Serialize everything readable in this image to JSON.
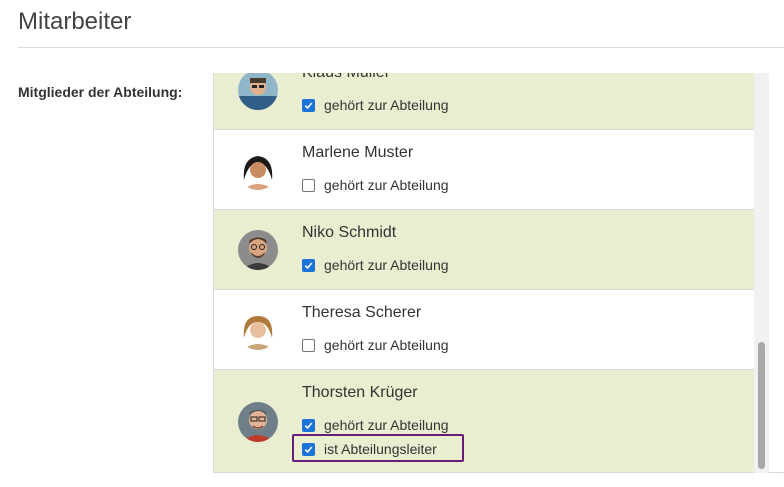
{
  "page": {
    "title": "Mitarbeiter"
  },
  "field": {
    "label": "Mitglieder der Abteilung:"
  },
  "members": [
    {
      "name": "Klaus Müller",
      "selected": true,
      "checkbox_label": "gehört zur Abteilung",
      "avatar": "avatar-klaus"
    },
    {
      "name": "Marlene Muster",
      "selected": false,
      "checkbox_label": "gehört zur Abteilung",
      "avatar": "avatar-marlene"
    },
    {
      "name": "Niko Schmidt",
      "selected": true,
      "checkbox_label": "gehört zur Abteilung",
      "avatar": "avatar-niko"
    },
    {
      "name": "Theresa Scherer",
      "selected": false,
      "checkbox_label": "gehört zur Abteilung",
      "avatar": "avatar-theresa"
    },
    {
      "name": "Thorsten Krüger",
      "selected": true,
      "checkbox_label": "gehört zur Abteilung",
      "head_checkbox_label": "ist Abteilungsleiter",
      "is_head": true,
      "avatar": "avatar-thorsten"
    }
  ],
  "colors": {
    "selected_row": "#e8eecf",
    "checkbox_checked": "#1a73d9",
    "highlight_border": "#6a1b7a"
  }
}
